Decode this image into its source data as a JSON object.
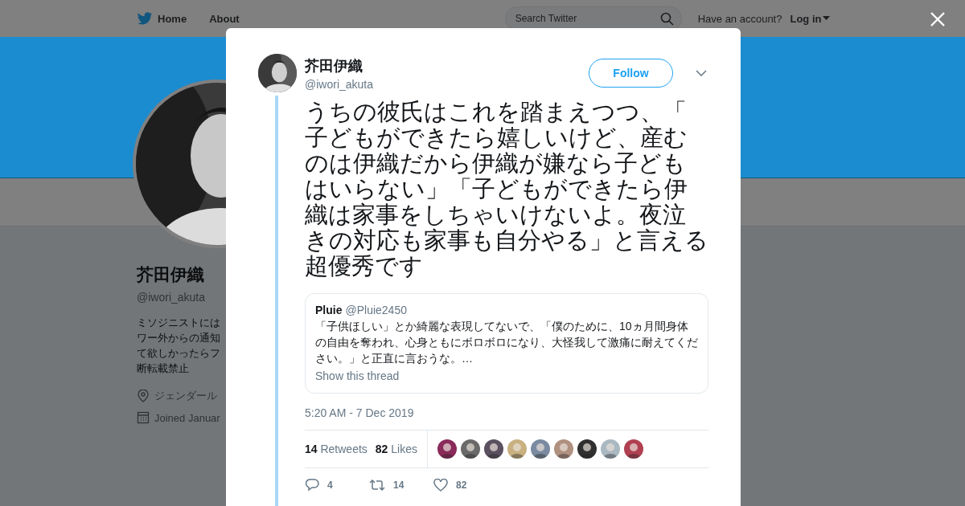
{
  "top_nav": {
    "links": [
      {
        "label": "Home"
      },
      {
        "label": "About"
      }
    ],
    "search": {
      "placeholder": "Search Twitter"
    },
    "account_prompt": "Have an account?",
    "login": "Log in"
  },
  "profile": {
    "name": "芥田伊織",
    "handle": "@iwori_akuta",
    "bio_lines": [
      "ミソジニストには",
      "ワー外からの通知",
      "て欲しかったらフ",
      "断転載禁止"
    ],
    "location": "ジェンダール",
    "joined": "Joined Januar"
  },
  "tweet": {
    "name": "芥田伊織",
    "handle": "@iwori_akuta",
    "follow": "Follow",
    "text": "うちの彼氏はこれを踏まえつつ、「子どもができたら嬉しいけど、産むのは伊織だから伊織が嫌なら子どもはいらない」「子どもができたら伊織は家事をしちゃいけないよ。夜泣きの対応も家事も自分やる」と言える超優秀です",
    "quote": {
      "name": "Pluie",
      "handle": "@Pluie2450",
      "text": "「子供ほしい」とか綺麗な表現してないで、「僕のために、10ヵ月間身体の自由を奪われ、心身ともにボロボロになり、大怪我して激痛に耐えてください。」と正直に言おうな。…",
      "link": "Show this thread"
    },
    "timestamp": "5:20 AM - 7 Dec 2019",
    "stats": [
      {
        "count": "14",
        "label": "Retweets"
      },
      {
        "count": "82",
        "label": "Likes"
      }
    ],
    "likers": [
      {
        "color": "#8a2a5a"
      },
      {
        "color": "#6a6a6a"
      },
      {
        "color": "#5a5060"
      },
      {
        "color": "#c8b080"
      },
      {
        "color": "#7a8aa0"
      },
      {
        "color": "#b09080"
      },
      {
        "color": "#303030"
      },
      {
        "color": "#aab8c2"
      },
      {
        "color": "#b04050"
      }
    ],
    "actions": [
      {
        "kind": "reply",
        "count": "4"
      },
      {
        "kind": "retweet",
        "count": "14"
      },
      {
        "kind": "like",
        "count": "82"
      }
    ]
  }
}
